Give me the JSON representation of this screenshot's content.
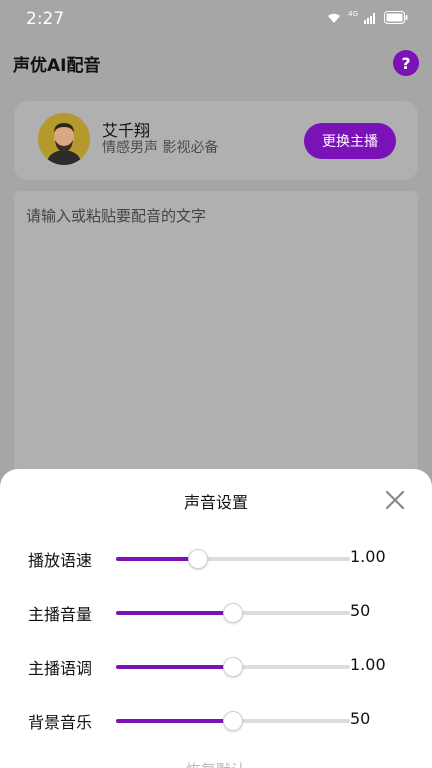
{
  "status_bar": {
    "time": "2:27",
    "network": "4G"
  },
  "app": {
    "title": "声优AI配音",
    "help_label": "?"
  },
  "host": {
    "name": "艾千翔",
    "description": "情感男声 影视必备",
    "change_button": "更换主播"
  },
  "editor": {
    "placeholder": "请输入或粘贴要配音的文字"
  },
  "sheet": {
    "title": "声音设置",
    "sliders": [
      {
        "label": "播放语速",
        "value": "1.00",
        "fraction": 0.35
      },
      {
        "label": "主播音量",
        "value": "50",
        "fraction": 0.5
      },
      {
        "label": "主播语调",
        "value": "1.00",
        "fraction": 0.5
      },
      {
        "label": "背景音乐",
        "value": "50",
        "fraction": 0.5
      }
    ],
    "reset_label": "恢复默认"
  },
  "colors": {
    "accent": "#7b12b8",
    "overlay": "#a6a6a6"
  }
}
